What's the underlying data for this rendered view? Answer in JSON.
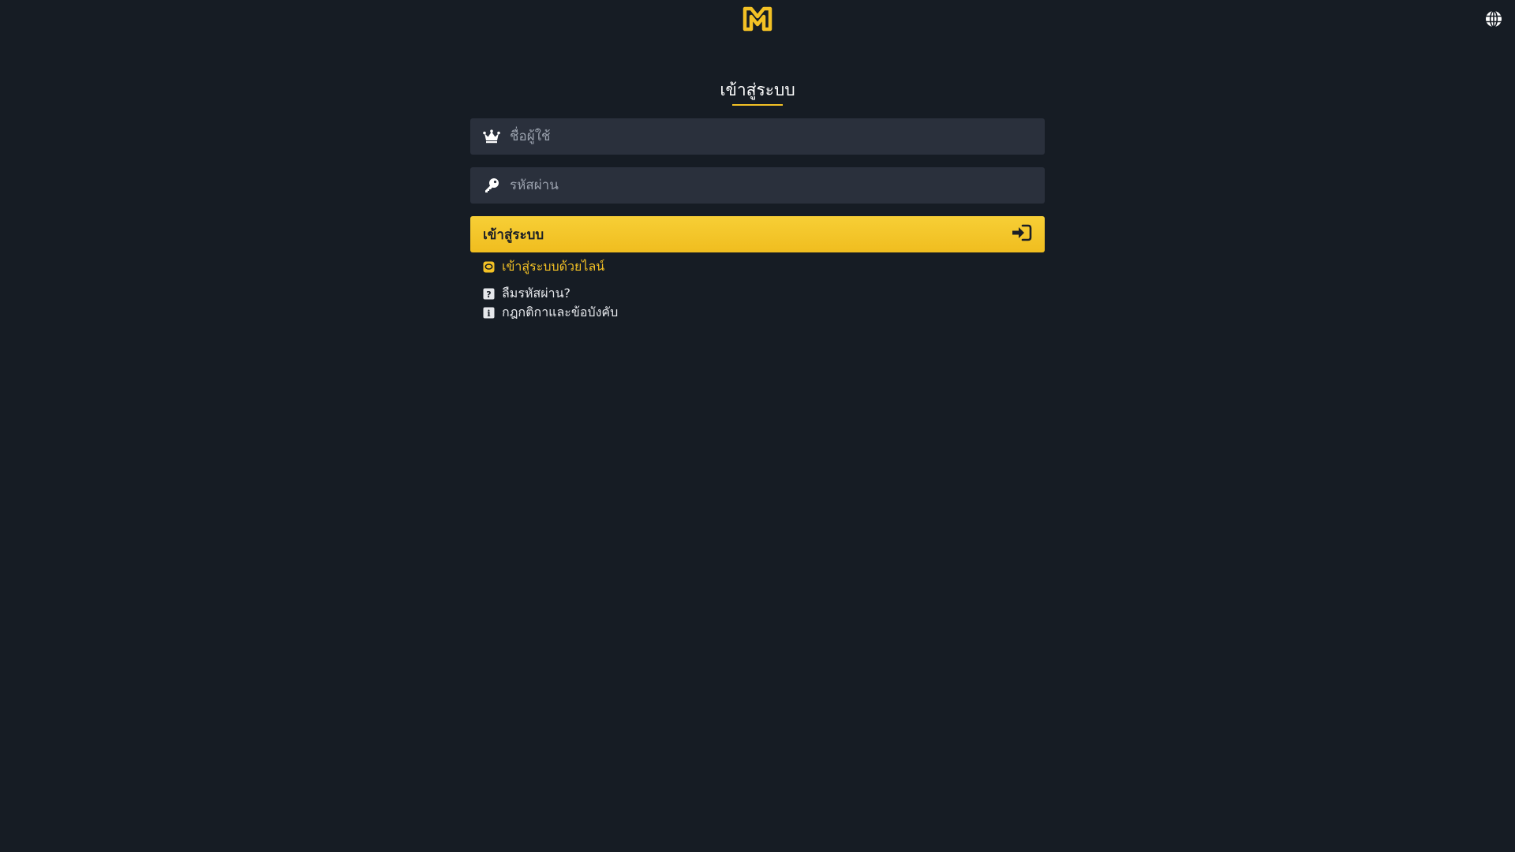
{
  "header": {
    "logo_icon": "butterfly-m-logo",
    "language_icon": "globe-icon"
  },
  "form": {
    "title": "เข้าสู่ระบบ",
    "username": {
      "icon": "crown-icon",
      "placeholder": "ชื่อผู้ใช้",
      "value": ""
    },
    "password": {
      "icon": "key-icon",
      "placeholder": "รหัสผ่าน",
      "value": ""
    },
    "submit": {
      "label": "เข้าสู่ระบบ",
      "icon": "sign-in-icon"
    }
  },
  "links": {
    "line_login": "เข้าสู่ระบบด้วยไลน์",
    "forgot_password": "ลืมรหัสผ่าน?",
    "terms": "กฎกติกาและข้อบังคับ"
  },
  "colors": {
    "background": "#161c24",
    "field": "#2a303c",
    "accent": "#f3c125",
    "button_text": "#1b1f27"
  }
}
